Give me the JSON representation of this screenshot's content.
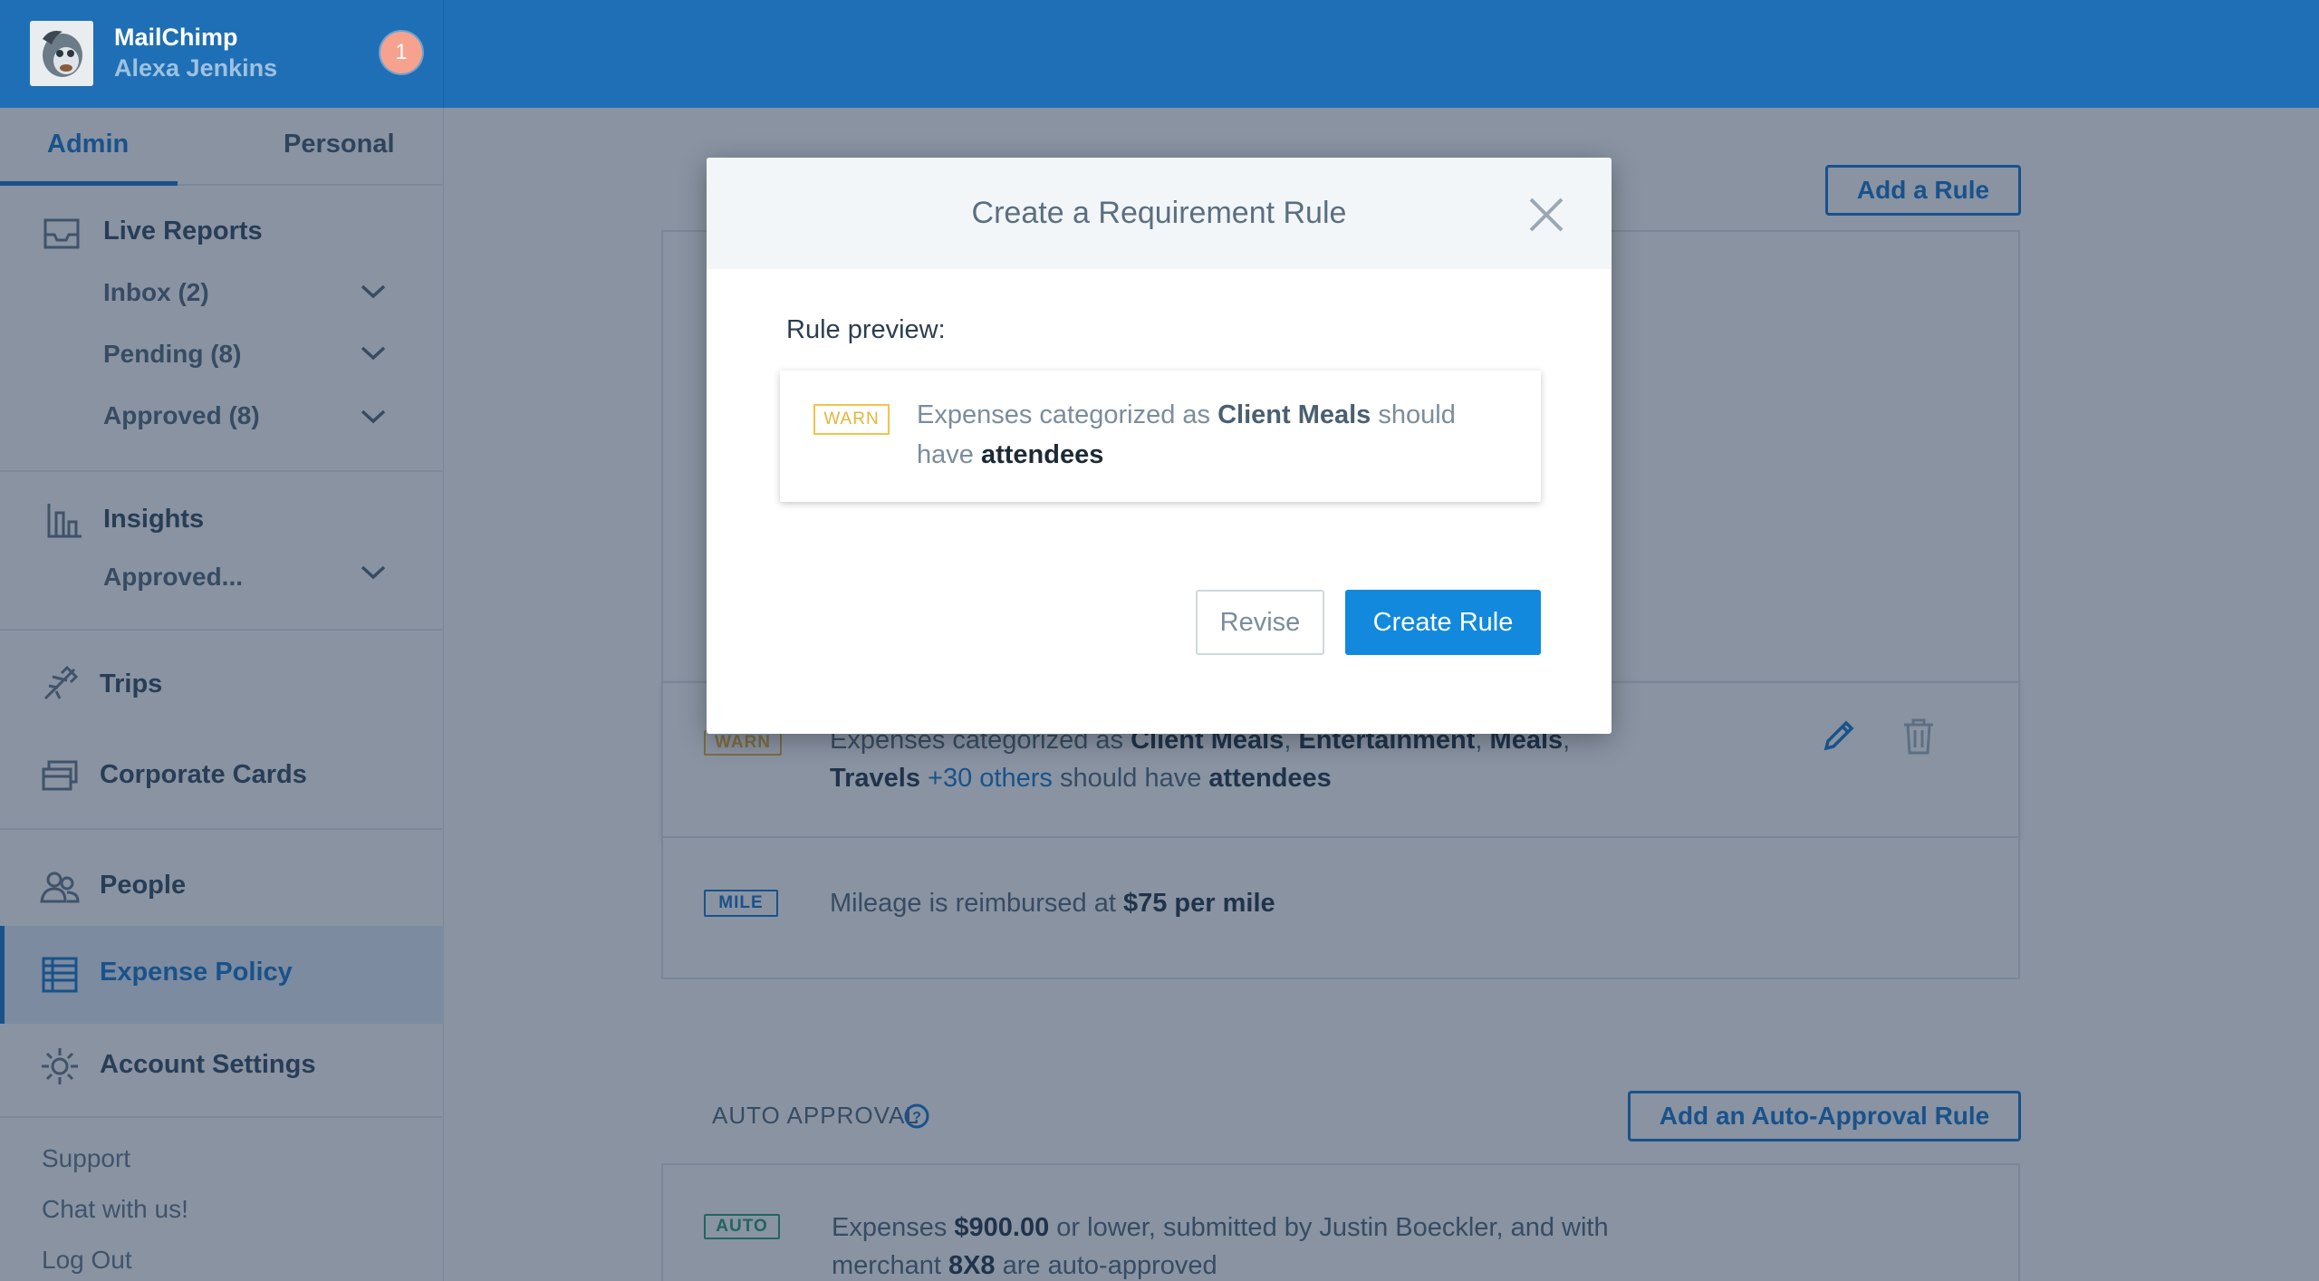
{
  "header": {
    "org_name": "MailChimp",
    "user_name": "Alexa Jenkins",
    "notification_count": "1"
  },
  "sidebar": {
    "tabs": [
      {
        "label": "Admin",
        "active": true
      },
      {
        "label": "Personal",
        "active": false
      }
    ],
    "live_reports": {
      "label": "Live Reports",
      "items": [
        {
          "label": "Inbox (2)"
        },
        {
          "label": "Pending (8)"
        },
        {
          "label": "Approved (8)"
        }
      ]
    },
    "insights": {
      "label": "Insights",
      "items": [
        {
          "label": "Approved..."
        }
      ]
    },
    "nav": [
      {
        "label": "Trips",
        "icon": "plane-icon"
      },
      {
        "label": "Corporate Cards",
        "icon": "cards-icon"
      },
      {
        "label": "People",
        "icon": "people-icon"
      },
      {
        "label": "Expense Policy",
        "icon": "policy-icon",
        "active": true
      },
      {
        "label": "Account Settings",
        "icon": "gear-icon"
      }
    ],
    "footer": [
      {
        "label": "Support"
      },
      {
        "label": "Chat with us!"
      },
      {
        "label": "Log Out"
      }
    ]
  },
  "main": {
    "add_rule_label": "Add a Rule",
    "rules": [
      {
        "tag": "WARN",
        "text_a": "Expenses categorized as ",
        "cat1": "Client Meals",
        "sep1": ", ",
        "cat2": "Entertainment",
        "sep2": ", ",
        "cat3": "Meals",
        "sep3": ",",
        "cat4": "Travels",
        "others": "+30 others",
        "text_b": " should have ",
        "field": "attendees"
      },
      {
        "tag": "MILE",
        "text_a": "Mileage is reimbursed at ",
        "rate": "$75 per mile"
      }
    ],
    "auto_approval": {
      "section_label": "AUTO APPROVAL",
      "add_label": "Add an Auto-Approval Rule",
      "rule": {
        "tag": "AUTO",
        "text_a": "Expenses ",
        "amount": "$900.00",
        "text_b": " or lower, submitted by Justin Boeckler, and with",
        "text_c": "merchant ",
        "merchant": "8X8",
        "text_d": " are auto-approved"
      }
    }
  },
  "modal": {
    "title": "Create a Requirement Rule",
    "preview_label": "Rule preview:",
    "preview": {
      "tag": "WARN",
      "text_a": "Expenses categorized as ",
      "category": "Client Meals",
      "text_b": " should",
      "text_c": "have ",
      "field": "attendees"
    },
    "revise_label": "Revise",
    "create_label": "Create Rule"
  },
  "colors": {
    "brand_blue": "#1e6fb5",
    "accent": "#1289dc",
    "warn": "#e7b33c",
    "auto": "#2fa37a"
  }
}
